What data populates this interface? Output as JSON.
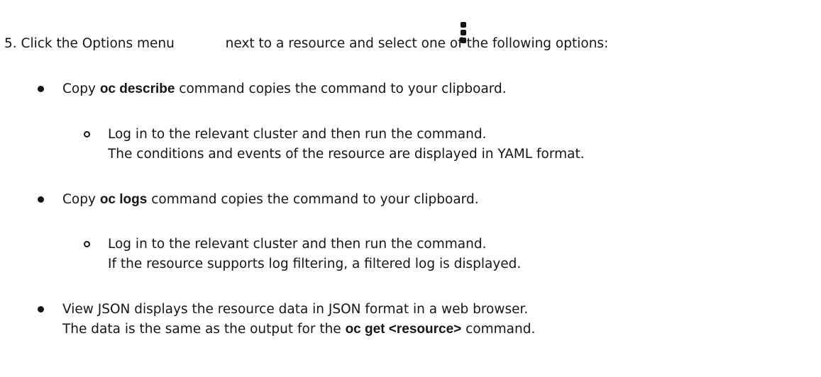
{
  "step": {
    "number": "5.",
    "text_before": "Click the Options menu",
    "text_after": "next to a resource and select one of the following options:",
    "icon": "kebab-icon"
  },
  "items": [
    {
      "label_prefix": "Copy ",
      "label_code": "oc describe",
      "label_suffix": " command",
      "description": " copies the command to your clipboard.",
      "sub_lines": [
        "Log in to the relevant cluster and then run the command.",
        "The conditions and events of the resource are displayed in YAML format."
      ]
    },
    {
      "label_prefix": "Copy ",
      "label_code": "oc logs",
      "label_suffix": " command",
      "description": " copies the command to your clipboard.",
      "sub_lines": [
        "Log in to the relevant cluster and then run the command.",
        "If the resource supports log filtering, a filtered log is displayed."
      ]
    },
    {
      "label": "View JSON",
      "description": " displays the resource data in JSON format in a web browser.",
      "line2_before": "The data is the same as the output for the ",
      "line2_code": "oc get <resource>",
      "line2_after": " command."
    }
  ]
}
